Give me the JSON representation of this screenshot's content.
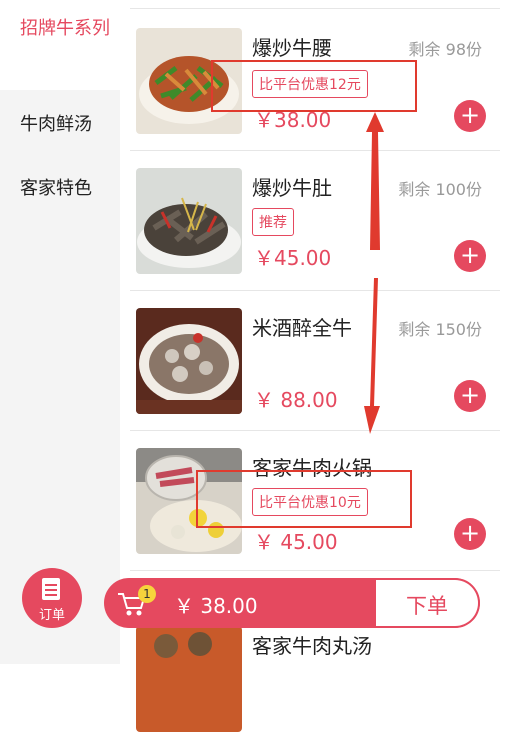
{
  "colors": {
    "accent": "#e5495f",
    "annotation": "#e03a2e",
    "badge": "#f7d33c"
  },
  "sidebar": {
    "items": [
      {
        "label": "招牌牛系列",
        "active": true
      },
      {
        "label": "牛肉鲜汤",
        "active": false
      },
      {
        "label": "客家特色",
        "active": false
      }
    ]
  },
  "dishes": [
    {
      "name": "爆炒牛腰",
      "stock": "剩余 98份",
      "tag": "比平台优惠12元",
      "price": "￥38.00",
      "image": "stir-fried-beef-kidney-photo"
    },
    {
      "name": "爆炒牛肚",
      "stock": "剩余 100份",
      "tag": "推荐",
      "price": "￥45.00",
      "image": "stir-fried-beef-tripe-photo"
    },
    {
      "name": "米酒醉全牛",
      "stock": "剩余 150份",
      "tag": "",
      "price": "￥ 88.00",
      "image": "rice-wine-beef-photo"
    },
    {
      "name": "客家牛肉火锅",
      "stock": "",
      "tag": "比平台优惠10元",
      "price": "￥ 45.00",
      "image": "hakka-beef-hotpot-photo"
    },
    {
      "name": "客家牛肉丸汤",
      "stock": "",
      "tag": "",
      "price": "",
      "image": "beef-ball-soup-photo"
    }
  ],
  "icons": {
    "add": "plus-icon",
    "order": "order-doc-icon",
    "cart": "cart-icon"
  },
  "add_symbol": "+",
  "bottom": {
    "order_label": "订单",
    "cart_count": "1",
    "cart_total": "￥ 38.00",
    "submit_label": "下单"
  }
}
